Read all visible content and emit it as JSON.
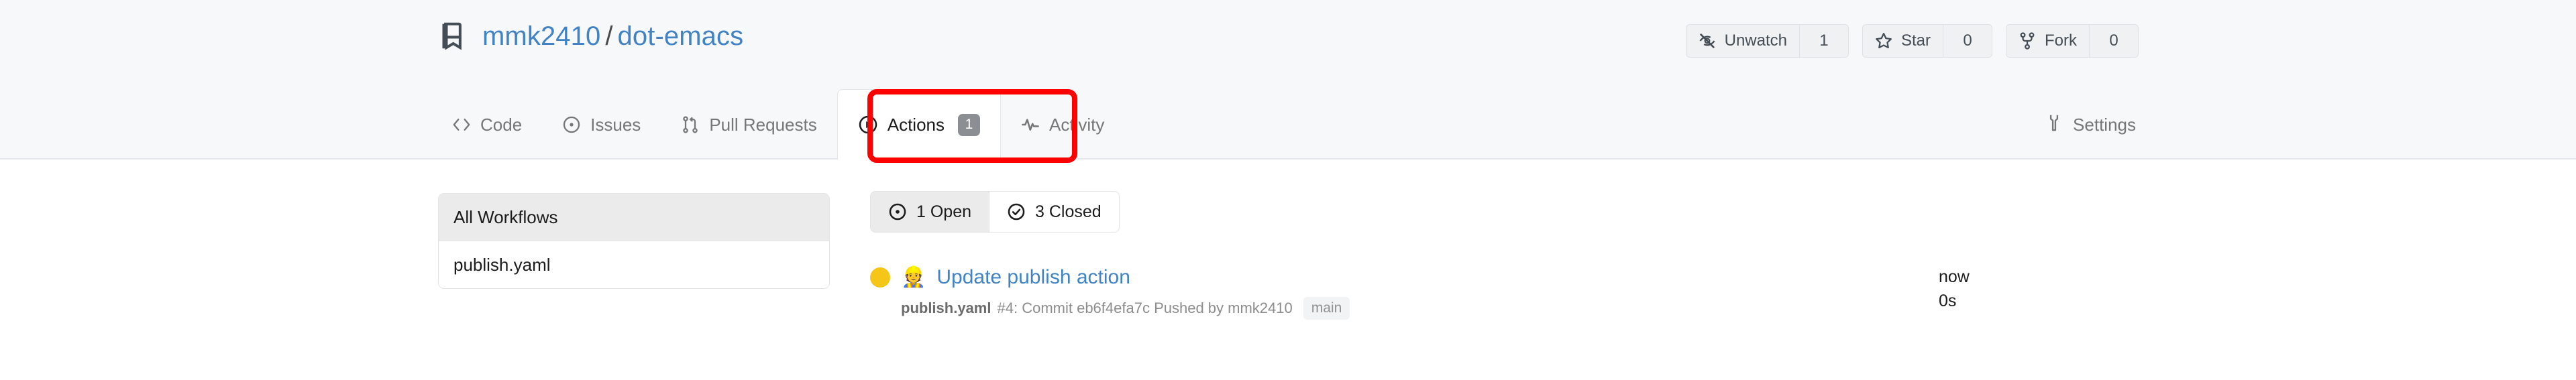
{
  "repo": {
    "icon": "repo-book-icon",
    "owner": "mmk2410",
    "separator": "/",
    "name": "dot-emacs"
  },
  "repo_actions": [
    {
      "icon": "eye-slash-icon",
      "label": "Unwatch",
      "count": "1"
    },
    {
      "icon": "star-icon",
      "label": "Star",
      "count": "0"
    },
    {
      "icon": "fork-icon",
      "label": "Fork",
      "count": "0"
    }
  ],
  "nav": {
    "items": [
      {
        "icon": "code-icon",
        "label": "Code",
        "active": false
      },
      {
        "icon": "issue-opened-icon",
        "label": "Issues",
        "active": false
      },
      {
        "icon": "git-pull-request-icon",
        "label": "Pull Requests",
        "active": false
      },
      {
        "icon": "play-circle-icon",
        "label": "Actions",
        "badge": "1",
        "active": true
      },
      {
        "icon": "activity-pulse-icon",
        "label": "Activity",
        "active": false
      }
    ],
    "settings": {
      "icon": "wrench-icon",
      "label": "Settings"
    }
  },
  "annotation": {
    "target": "Actions",
    "color": "#ff0000"
  },
  "sidebar": {
    "header": "All Workflows",
    "items": [
      {
        "label": "publish.yaml"
      }
    ]
  },
  "filters": [
    {
      "icon": "dot-circle-icon",
      "label": "1 Open",
      "selected": true
    },
    {
      "icon": "check-circle-icon",
      "label": "3 Closed",
      "selected": false
    }
  ],
  "runs": [
    {
      "status_color": "#f5c518",
      "status": "in-progress",
      "emoji": "👷",
      "title": "Update publish action",
      "workflow": "publish.yaml",
      "number": "#4",
      "meta": ": Commit eb6f4efa7c Pushed by mmk2410",
      "branch": "main",
      "time": "now",
      "duration": "0s"
    }
  ]
}
